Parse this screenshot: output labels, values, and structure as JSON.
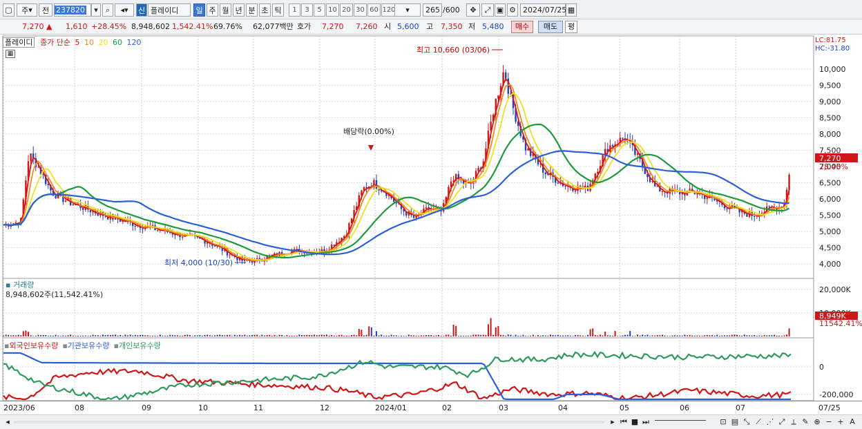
{
  "toolbar": {
    "period_label": "주",
    "prev_label": "전",
    "code": "237820",
    "market_badge": "신",
    "stock_name": "플레이디",
    "intervals": [
      "일",
      "주",
      "월",
      "년",
      "분",
      "초",
      "틱"
    ],
    "active_interval": "일",
    "numbers": [
      "1",
      "3",
      "5",
      "10",
      "20",
      "30",
      "60",
      "120"
    ],
    "count": "265",
    "count_total": "/600",
    "date": "2024/07/25"
  },
  "quote": {
    "price": "7,270",
    "change": "1,610",
    "change_pct": "+28.45%",
    "volume": "8,948,602",
    "volume_pct": "1,542.41%",
    "turnover_pct": "69.76%",
    "amount": "62,077백만",
    "bid_label": "호가",
    "ask": "7,270",
    "bid": "7,260",
    "open_label": "시",
    "open": "5,600",
    "high_label": "고",
    "high": "7,350",
    "low_label": "저",
    "low": "5,480",
    "buy_label": "매수",
    "sell_label": "매도",
    "avg_label": "평"
  },
  "price_panel": {
    "name_tag": "플레이디",
    "ma_label": "종가 단순",
    "ma_periods": [
      "5",
      "10",
      "20",
      "60",
      "120"
    ],
    "ma_colors": [
      "#e01010",
      "#f08c1e",
      "#f0e020",
      "#1c9a3c",
      "#2b5fd9"
    ],
    "lc": "LC:81.75",
    "hc": "HC:-31.80",
    "y_ticks": [
      "10,000",
      "9,500",
      "9,000",
      "8,500",
      "8,000",
      "7,500",
      "7,000",
      "6,500",
      "6,000",
      "5,500",
      "5,000",
      "4,500",
      "4,000"
    ],
    "last_price_tag": "7,270",
    "last_pct_tag": "28.45%",
    "annotation_high": "최고 10,660 (03/06)",
    "annotation_low": "최저 4,000 (10/30)",
    "annotation_div": "배당락(0.00%)"
  },
  "volume_panel": {
    "title": "거래량",
    "subtitle": "8,948,602주(11,542.41%)",
    "y_ticks": [
      "20,000K",
      "10,000K"
    ],
    "last_tag": "8,949K",
    "last_pct_tag": "11542.41%"
  },
  "holders_panel": {
    "labels": [
      "외국인보유수량",
      "기관보유수량",
      "개인보유수량"
    ],
    "colors": [
      "#d01616",
      "#2b5fd9",
      "#2e9a5e"
    ],
    "y_ticks": [
      "0",
      "-200,000"
    ]
  },
  "x_axis": [
    {
      "label": "2023/06",
      "x": 5
    },
    {
      "label": "08",
      "x": 108
    },
    {
      "label": "09",
      "x": 205
    },
    {
      "label": "10",
      "x": 287
    },
    {
      "label": "11",
      "x": 367
    },
    {
      "label": "12",
      "x": 463
    },
    {
      "label": "2024/01",
      "x": 543
    },
    {
      "label": "02",
      "x": 640
    },
    {
      "label": "03",
      "x": 722
    },
    {
      "label": "04",
      "x": 808
    },
    {
      "label": "05",
      "x": 897
    },
    {
      "label": "06",
      "x": 984
    },
    {
      "label": "07",
      "x": 1065
    },
    {
      "label": "07/25",
      "x": 1185
    }
  ]
}
